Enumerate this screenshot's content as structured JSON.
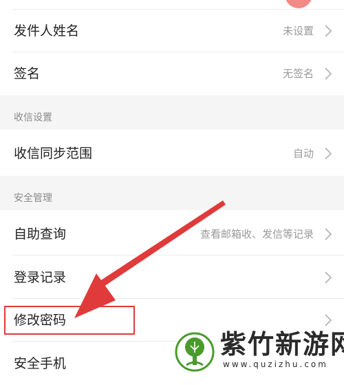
{
  "settings": {
    "sender_name": {
      "label": "发件人姓名",
      "value": "未设置"
    },
    "signature": {
      "label": "签名",
      "value": "无签名"
    },
    "receive_section_title": "收信设置",
    "sync_range": {
      "label": "收信同步范围",
      "value": "自动"
    },
    "security_section_title": "安全管理",
    "self_query": {
      "label": "自助查询",
      "value": "查看邮箱收、发信等记录"
    },
    "login_records": {
      "label": "登录记录"
    },
    "change_password": {
      "label": "修改密码"
    },
    "security_phone": {
      "label": "安全手机"
    }
  },
  "watermark": {
    "name": "紫竹新游网",
    "url": "www.quzizhu.com"
  },
  "colors": {
    "annotation_red": "#e03a3a",
    "watermark_green": "#4a9a2c",
    "avatar_pink": "#f28a86"
  },
  "icons": [
    "chevron-right-icon",
    "tree-logo-icon"
  ]
}
